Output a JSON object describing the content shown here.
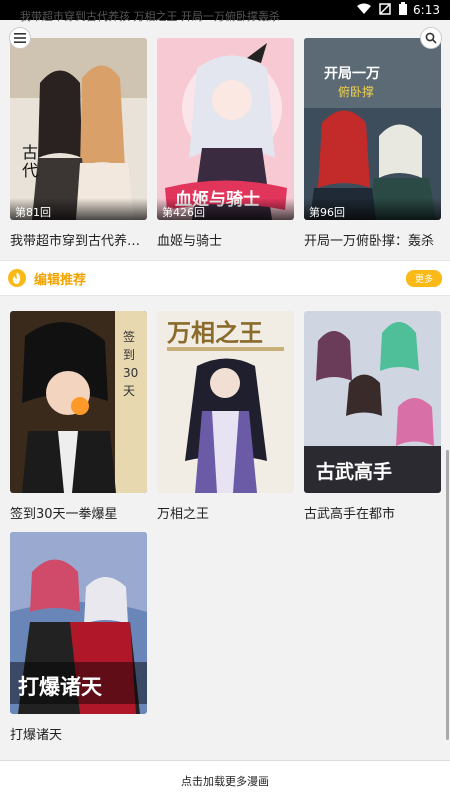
{
  "status_bar": {
    "time": "6:13",
    "cut_text": "我带超市穿到古代养孩 万相之王 开局一万俯卧撑轰杀"
  },
  "row1": [
    {
      "title": "我带超市穿到古代养孩子",
      "episode": "第81回"
    },
    {
      "title": "血姬与骑士",
      "episode": "第426回"
    },
    {
      "title": "开局一万俯卧撑：轰杀",
      "episode": "第96回"
    }
  ],
  "section": {
    "title": "编辑推荐",
    "more": "更多"
  },
  "row2": [
    {
      "title": "签到30天一拳爆星"
    },
    {
      "title": "万相之王"
    },
    {
      "title": "古武高手在都市"
    }
  ],
  "row3": [
    {
      "title": "打爆诸天"
    }
  ],
  "load_more": "点击加载更多漫画",
  "colors": {
    "accent": "#f9b916",
    "accent_text": "#f3a300"
  }
}
